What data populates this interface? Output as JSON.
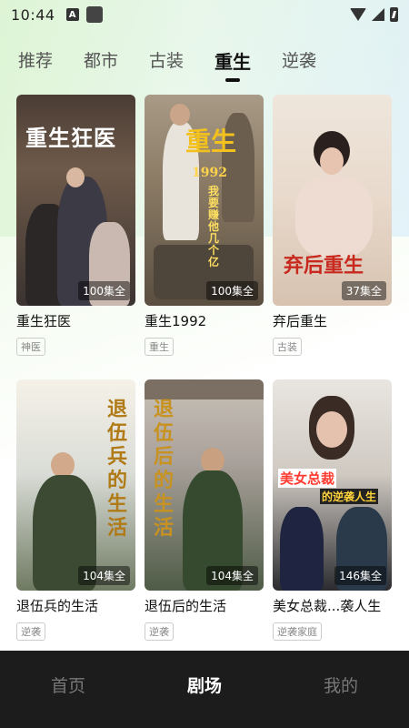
{
  "status": {
    "time": "10:44"
  },
  "tabs": [
    {
      "label": "推荐"
    },
    {
      "label": "都市"
    },
    {
      "label": "古装"
    },
    {
      "label": "重生"
    },
    {
      "label": "逆袭"
    }
  ],
  "active_tab": "重生",
  "cards": [
    {
      "title": "重生狂医",
      "episodes": "100集全",
      "tag": "神医",
      "poster_text": "重生狂医"
    },
    {
      "title": "重生1992",
      "episodes": "100集全",
      "tag": "重生",
      "poster_text": "重生",
      "poster_sub": "1992",
      "poster_sub2": "我要赚他几个亿"
    },
    {
      "title": "弃后重生",
      "episodes": "37集全",
      "tag": "古装",
      "poster_text": "弃后重生"
    },
    {
      "title": "退伍兵的生活",
      "episodes": "104集全",
      "tag": "逆袭",
      "poster_text": "退伍兵的生活"
    },
    {
      "title": "退伍后的生活",
      "episodes": "104集全",
      "tag": "逆袭",
      "poster_text": "退伍后的生活"
    },
    {
      "title": "美女总裁...袭人生",
      "episodes": "146集全",
      "tag": "逆袭家庭",
      "poster_text": "美女总裁",
      "poster_sub": "的逆袭人生"
    }
  ],
  "bottom_nav": [
    {
      "label": "首页"
    },
    {
      "label": "剧场"
    },
    {
      "label": "我的"
    }
  ],
  "active_nav": "剧场"
}
